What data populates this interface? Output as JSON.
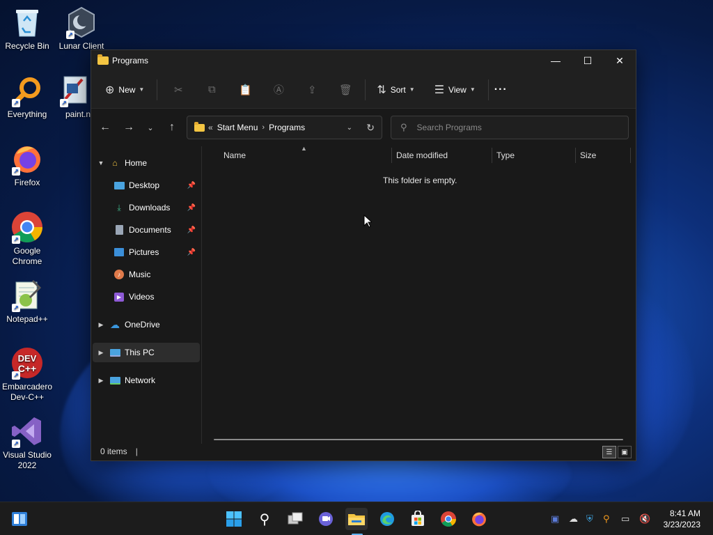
{
  "desktop": {
    "icons": [
      {
        "label": "Recycle Bin"
      },
      {
        "label": "Lunar Client"
      },
      {
        "label": "Everything"
      },
      {
        "label": "paint.n"
      },
      {
        "label": "Firefox"
      },
      {
        "label": "Google Chrome"
      },
      {
        "label": "Notepad++"
      },
      {
        "label": "Embarcadero Dev-C++"
      },
      {
        "label": "Visual Studio 2022"
      }
    ]
  },
  "window": {
    "title": "Programs",
    "controls": {
      "minimize": "—",
      "maximize": "☐",
      "close": "✕"
    }
  },
  "toolbar": {
    "new_label": "New",
    "sort_label": "Sort",
    "view_label": "View",
    "more_label": "···"
  },
  "address": {
    "overflow": "«",
    "crumbs": [
      "Start Menu",
      "Programs"
    ],
    "separator": "›"
  },
  "search": {
    "placeholder": "Search Programs"
  },
  "nav": {
    "home": "Home",
    "desktop": "Desktop",
    "downloads": "Downloads",
    "documents": "Documents",
    "pictures": "Pictures",
    "music": "Music",
    "videos": "Videos",
    "onedrive": "OneDrive",
    "thispc": "This PC",
    "network": "Network"
  },
  "columns": {
    "name": "Name",
    "date_modified": "Date modified",
    "type": "Type",
    "size": "Size"
  },
  "content": {
    "empty_message": "This folder is empty."
  },
  "status": {
    "items": "0 items",
    "separator": "|"
  },
  "clock": {
    "time": "8:41 AM",
    "date": "3/23/2023"
  },
  "colors": {
    "accent": "#5fb2f2",
    "folder": "#f4c542",
    "window_bg": "#191919",
    "toolbar_bg": "#202020"
  }
}
